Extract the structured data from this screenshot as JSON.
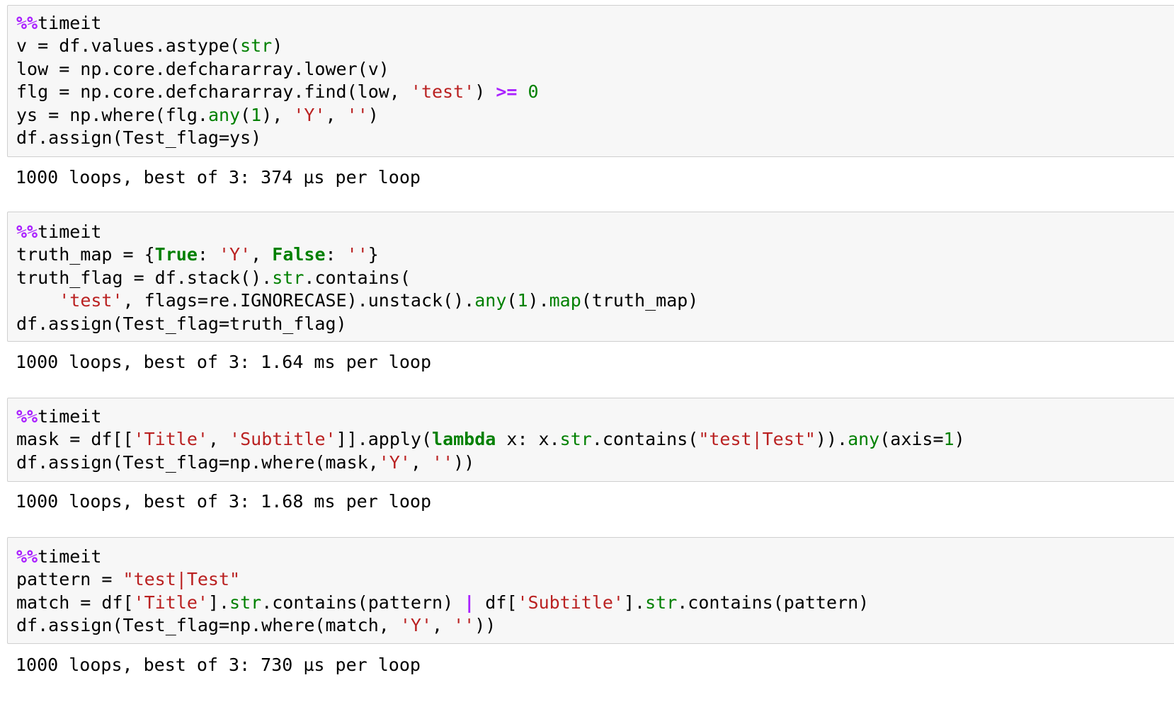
{
  "cells": [
    {
      "code": [
        [
          {
            "t": "%%",
            "c": "magic"
          },
          {
            "t": "timeit"
          }
        ],
        [
          {
            "t": "v = df.values.astype("
          },
          {
            "t": "str",
            "c": "bi"
          },
          {
            "t": ")"
          }
        ],
        [
          {
            "t": "low = np.core.defchararray.lower(v)"
          }
        ],
        [
          {
            "t": "flg = np.core.defchararray.find(low, "
          },
          {
            "t": "'test'",
            "c": "str"
          },
          {
            "t": ") "
          },
          {
            "t": ">=",
            "c": "op"
          },
          {
            "t": " "
          },
          {
            "t": "0",
            "c": "num"
          }
        ],
        [
          {
            "t": "ys = np.where(flg."
          },
          {
            "t": "any",
            "c": "bi"
          },
          {
            "t": "("
          },
          {
            "t": "1",
            "c": "num"
          },
          {
            "t": "), "
          },
          {
            "t": "'Y'",
            "c": "str"
          },
          {
            "t": ", "
          },
          {
            "t": "''",
            "c": "str"
          },
          {
            "t": ")"
          }
        ],
        [
          {
            "t": "df.assign(Test_flag=ys)"
          }
        ]
      ],
      "output": "1000 loops, best of 3: 374 µs per loop"
    },
    {
      "code": [
        [
          {
            "t": "%%",
            "c": "magic"
          },
          {
            "t": "timeit"
          }
        ],
        [
          {
            "t": "truth_map = {"
          },
          {
            "t": "True",
            "c": "kw"
          },
          {
            "t": ": "
          },
          {
            "t": "'Y'",
            "c": "str"
          },
          {
            "t": ", "
          },
          {
            "t": "False",
            "c": "kw"
          },
          {
            "t": ": "
          },
          {
            "t": "''",
            "c": "str"
          },
          {
            "t": "}"
          }
        ],
        [
          {
            "t": "truth_flag = df.stack()."
          },
          {
            "t": "str",
            "c": "bi"
          },
          {
            "t": ".contains("
          }
        ],
        [
          {
            "t": "    "
          },
          {
            "t": "'test'",
            "c": "str"
          },
          {
            "t": ", flags=re.IGNORECASE).unstack()."
          },
          {
            "t": "any",
            "c": "bi"
          },
          {
            "t": "("
          },
          {
            "t": "1",
            "c": "num"
          },
          {
            "t": ")."
          },
          {
            "t": "map",
            "c": "bi"
          },
          {
            "t": "(truth_map)"
          }
        ],
        [
          {
            "t": "df.assign(Test_flag=truth_flag)"
          }
        ]
      ],
      "output": "1000 loops, best of 3: 1.64 ms per loop"
    },
    {
      "code": [
        [
          {
            "t": "%%",
            "c": "magic"
          },
          {
            "t": "timeit"
          }
        ],
        [
          {
            "t": "mask = df[["
          },
          {
            "t": "'Title'",
            "c": "str"
          },
          {
            "t": ", "
          },
          {
            "t": "'Subtitle'",
            "c": "str"
          },
          {
            "t": "]].apply("
          },
          {
            "t": "lambda",
            "c": "kw"
          },
          {
            "t": " x: x."
          },
          {
            "t": "str",
            "c": "bi"
          },
          {
            "t": ".contains("
          },
          {
            "t": "\"test|Test\"",
            "c": "str"
          },
          {
            "t": "))."
          },
          {
            "t": "any",
            "c": "bi"
          },
          {
            "t": "(axis="
          },
          {
            "t": "1",
            "c": "num"
          },
          {
            "t": ")"
          }
        ],
        [
          {
            "t": "df.assign(Test_flag=np.where(mask,"
          },
          {
            "t": "'Y'",
            "c": "str"
          },
          {
            "t": ", "
          },
          {
            "t": "''",
            "c": "str"
          },
          {
            "t": "))"
          }
        ]
      ],
      "output": "1000 loops, best of 3: 1.68 ms per loop"
    },
    {
      "code": [
        [
          {
            "t": "%%",
            "c": "magic"
          },
          {
            "t": "timeit"
          }
        ],
        [
          {
            "t": "pattern = "
          },
          {
            "t": "\"test|Test\"",
            "c": "str"
          }
        ],
        [
          {
            "t": "match = df["
          },
          {
            "t": "'Title'",
            "c": "str"
          },
          {
            "t": "]."
          },
          {
            "t": "str",
            "c": "bi"
          },
          {
            "t": ".contains(pattern) "
          },
          {
            "t": "|",
            "c": "op"
          },
          {
            "t": " df["
          },
          {
            "t": "'Subtitle'",
            "c": "str"
          },
          {
            "t": "]."
          },
          {
            "t": "str",
            "c": "bi"
          },
          {
            "t": ".contains(pattern)"
          }
        ],
        [
          {
            "t": "df.assign(Test_flag=np.where(match, "
          },
          {
            "t": "'Y'",
            "c": "str"
          },
          {
            "t": ", "
          },
          {
            "t": "''",
            "c": "str"
          },
          {
            "t": "))"
          }
        ]
      ],
      "output": "1000 loops, best of 3: 730 µs per loop"
    }
  ]
}
